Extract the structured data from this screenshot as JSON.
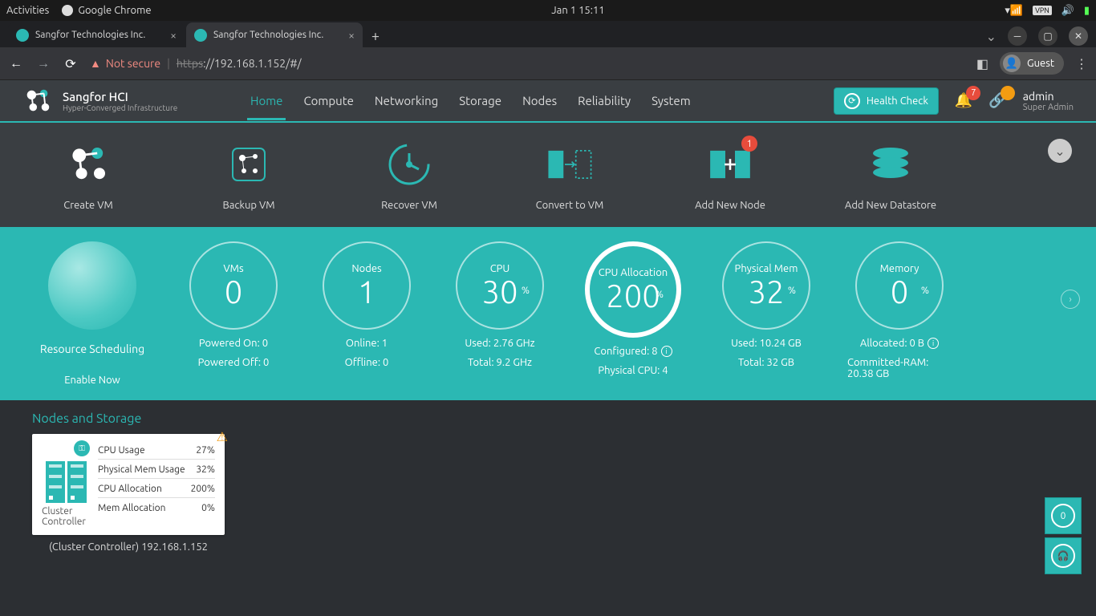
{
  "os": {
    "activities": "Activities",
    "app_name": "Google Chrome",
    "datetime": "Jan 1  15:11",
    "vpn": "VPN"
  },
  "browser": {
    "tabs": [
      {
        "title": "Sangfor Technologies Inc.",
        "active": false
      },
      {
        "title": "Sangfor Technologies Inc.",
        "active": true
      }
    ],
    "not_secure": "Not secure",
    "url_proto": "https",
    "url_rest": "://192.168.1.152/#/",
    "guest": "Guest"
  },
  "header": {
    "product": "Sangfor HCI",
    "tagline": "Hyper-Converged Infrastructure",
    "nav": [
      "Home",
      "Compute",
      "Networking",
      "Storage",
      "Nodes",
      "Reliability",
      "System"
    ],
    "active_nav": "Home",
    "health_check": "Health Check",
    "bell_count": "7",
    "user": {
      "name": "admin",
      "role": "Super Admin"
    }
  },
  "actions": [
    {
      "label": "Create VM"
    },
    {
      "label": "Backup VM"
    },
    {
      "label": "Recover VM"
    },
    {
      "label": "Convert to VM"
    },
    {
      "label": "Add New Node",
      "badge": "1"
    },
    {
      "label": "Add New Datastore"
    }
  ],
  "scheduling": {
    "title": "Resource Scheduling",
    "cta": "Enable Now"
  },
  "stats": [
    {
      "name": "VMs",
      "value": "0",
      "pct": false,
      "line1": "Powered On: 0",
      "line2": "Powered Off: 0"
    },
    {
      "name": "Nodes",
      "value": "1",
      "pct": false,
      "line1": "Online: 1",
      "line2": "Offline: 0"
    },
    {
      "name": "CPU",
      "value": "30",
      "pct": true,
      "line1": "Used: 2.76 GHz",
      "line2": "Total: 9.2 GHz"
    },
    {
      "name": "CPU Allocation",
      "value": "200",
      "pct": true,
      "filled": true,
      "line1": "Configured: 8",
      "line1_info": true,
      "line2": "Physical CPU: 4"
    },
    {
      "name": "Physical Mem",
      "value": "32",
      "pct": true,
      "line1": "Used: 10.24 GB",
      "line2": "Total: 32 GB"
    },
    {
      "name": "Memory",
      "value": "0",
      "pct": true,
      "line1": "Allocated: 0 B",
      "line1_info": true,
      "line2": "Committed-RAM: 20.38 GB"
    }
  ],
  "section": {
    "title": "Nodes and Storage",
    "node": {
      "role": "Cluster Controller",
      "metrics": [
        {
          "label": "CPU Usage",
          "value": "27%"
        },
        {
          "label": "Physical Mem Usage",
          "value": "32%"
        },
        {
          "label": "CPU Allocation",
          "value": "200%"
        },
        {
          "label": "Mem Allocation",
          "value": "0%"
        }
      ],
      "caption": "(Cluster Controller) 192.168.1.152"
    }
  },
  "float": {
    "count": "0"
  }
}
